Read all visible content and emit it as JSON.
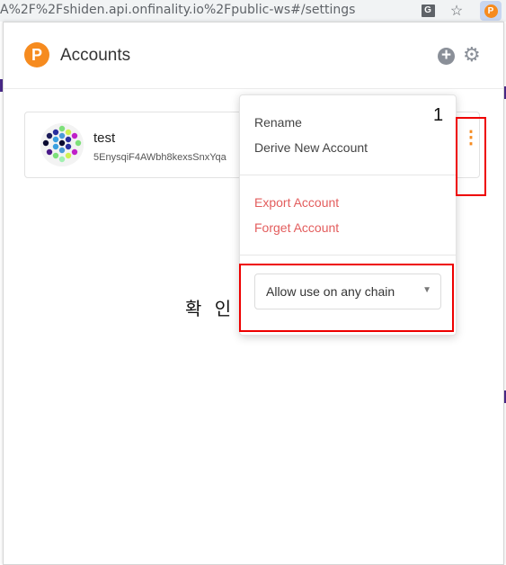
{
  "browser": {
    "url": "A%2F%2Fshiden.api.onfinality.io%2Fpublic-ws#/settings",
    "translate_icon_glyph": "G",
    "star_icon_glyph": "☆",
    "extension_icon_glyph": "P"
  },
  "header": {
    "logo_glyph": "P",
    "title": "Accounts",
    "add_icon_glyph": "+",
    "settings_icon_glyph": "⚙"
  },
  "account": {
    "name": "test",
    "address": "5EnysqiF4AWbh8kexsSnxYqa",
    "menu_icon_glyph": "⋮"
  },
  "menu": {
    "rename": "Rename",
    "derive": "Derive New Account",
    "export": "Export Account",
    "forget": "Forget Account",
    "chain_select_value": "Allow use on any chain",
    "caret_glyph": "▼"
  },
  "annotations": {
    "step_number": "1",
    "korean_text": "확 인"
  },
  "colors": {
    "accent": "#f68b1f",
    "danger": "#e35d5d",
    "annotation": "#e00000"
  }
}
